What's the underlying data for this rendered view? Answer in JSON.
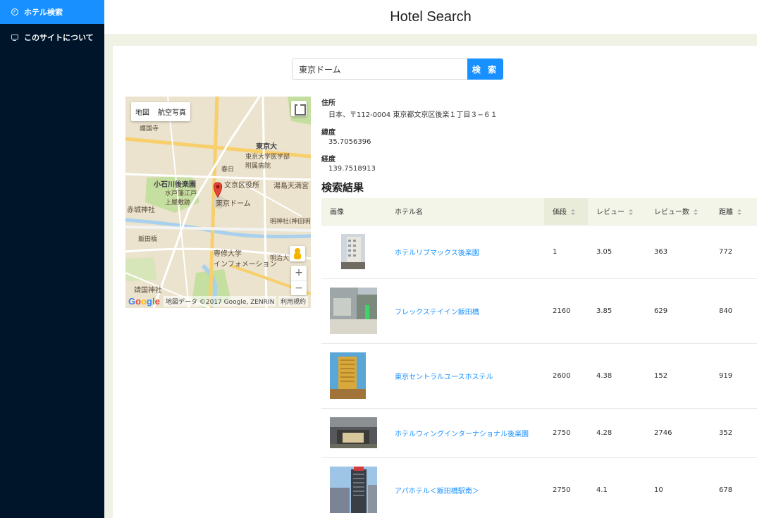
{
  "sidebar": {
    "items": [
      {
        "label": "ホテル検索",
        "icon": "dashboard-icon",
        "active": true
      },
      {
        "label": "このサイトについて",
        "icon": "desktop-icon",
        "active": false
      }
    ]
  },
  "header": {
    "title": "Hotel Search"
  },
  "search": {
    "value": "東京ドーム",
    "button_label": "検 索"
  },
  "map": {
    "type_map": "地図",
    "type_satellite": "航空写真",
    "zoom_in": "+",
    "zoom_out": "−",
    "attribution": "地図データ ©2017 Google, ZENRIN",
    "terms": "利用規約",
    "logo": "Google",
    "labels": {
      "tokyo_dome": "東京ドーム",
      "tokyo_univ": "東京大",
      "hospital": "東京大学医学部\n附属病院",
      "koishikawa": "小石川後楽園",
      "mito": "水戸藩江戸\n上屋敷跡",
      "akagi": "赤城神社",
      "ward": "文京区役所",
      "senshu": "専修大学\nインフォメーション",
      "yasukuni": "靖国神社",
      "kasuga": "春日",
      "iidabashi": "飯田橋",
      "yushima": "湯島天満宮",
      "kanda": "明神社(神田明",
      "meiji": "明治大",
      "gokoku": "護国寺"
    }
  },
  "info": {
    "address_label": "住所",
    "address": "日本、〒112-0004 東京都文京区後楽１丁目３−６１",
    "lat_label": "緯度",
    "lat": "35.7056396",
    "lng_label": "経度",
    "lng": "139.7518913",
    "results_title": "検索結果"
  },
  "table": {
    "columns": {
      "image": "画像",
      "name": "ホテル名",
      "price": "価段",
      "review": "レビュー",
      "review_count": "レビュー数",
      "distance": "距離"
    },
    "rows": [
      {
        "name": "ホテルリブマックス後楽園",
        "price": "1",
        "review": "3.05",
        "review_count": "363",
        "distance": "772"
      },
      {
        "name": "フレックステイイン飯田橋",
        "price": "2160",
        "review": "3.85",
        "review_count": "629",
        "distance": "840"
      },
      {
        "name": "東京セントラルユースホステル",
        "price": "2600",
        "review": "4.38",
        "review_count": "152",
        "distance": "919"
      },
      {
        "name": "ホテルウィングインターナショナル後楽園",
        "price": "2750",
        "review": "4.28",
        "review_count": "2746",
        "distance": "352"
      },
      {
        "name": "アパホテル＜飯田橋駅南＞",
        "price": "2750",
        "review": "4.1",
        "review_count": "10",
        "distance": "678"
      }
    ]
  },
  "colors": {
    "sidebar_bg": "#001529",
    "accent": "#1890ff",
    "page_bg": "#f0f2e6",
    "table_header_bg": "#f3f5e8"
  }
}
